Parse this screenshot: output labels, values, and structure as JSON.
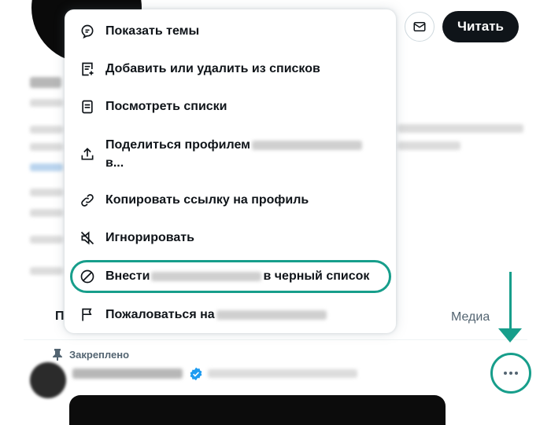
{
  "header": {
    "follow_label": "Читать",
    "mail_icon": "mail-icon"
  },
  "menu": {
    "items": [
      {
        "icon": "topics-icon",
        "label": "Показать темы"
      },
      {
        "icon": "list-add-icon",
        "label": "Добавить или удалить из списков"
      },
      {
        "icon": "lists-icon",
        "label": "Посмотреть списки"
      },
      {
        "icon": "share-icon",
        "label_start": "Поделиться профилем",
        "label_end": "в..."
      },
      {
        "icon": "link-icon",
        "label": "Копировать ссылку на профиль"
      },
      {
        "icon": "mute-icon",
        "label": "Игнорировать"
      },
      {
        "icon": "block-icon",
        "label_start": "Внести",
        "label_end": "в черный список"
      },
      {
        "icon": "flag-icon",
        "label_start": "Пожаловаться на"
      }
    ]
  },
  "tabs": {
    "first": "П",
    "media": "Медиа"
  },
  "post": {
    "pinned_label": "Закреплено",
    "more_icon": "more-horizontal-icon"
  },
  "colors": {
    "accent_annotation": "#179e8b",
    "follow_bg": "#0f1419",
    "verified_blue": "#1d9bf0"
  }
}
